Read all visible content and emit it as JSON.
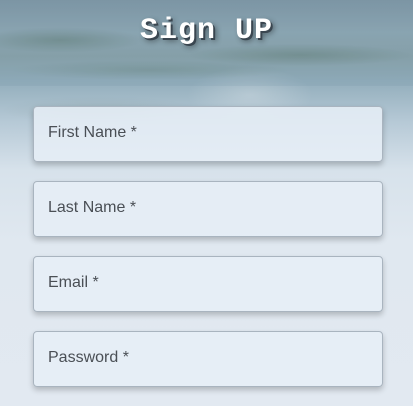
{
  "header": {
    "title": "Sign UP"
  },
  "form": {
    "fields": [
      {
        "label": "First Name *",
        "value": ""
      },
      {
        "label": "Last Name *",
        "value": ""
      },
      {
        "label": "Email *",
        "value": ""
      },
      {
        "label": "Password *",
        "value": ""
      }
    ]
  },
  "colors": {
    "title_text": "#ffffff",
    "field_border": "#a9b4bf",
    "field_label": "#4a4f55",
    "background": "#e2e9f1"
  }
}
